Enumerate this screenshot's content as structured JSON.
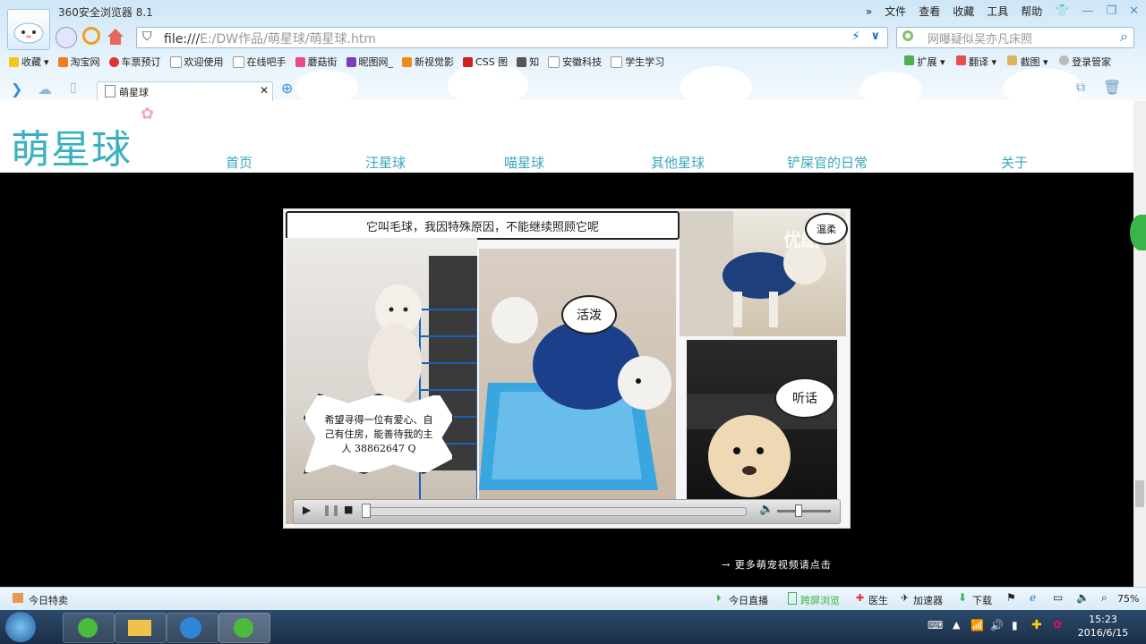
{
  "browser": {
    "app_title": "360安全浏览器 8.1",
    "menu": [
      "文件",
      "查看",
      "收藏",
      "工具",
      "帮助"
    ],
    "address_prefix": "file:///",
    "address_path": "E:/DW作品/萌星球/萌星球.htm",
    "search_placeholder": "网曝疑似吴亦凡床照",
    "bookmarks": [
      "收藏",
      "淘宝网",
      "车票预订",
      "欢迎使用",
      "在线吧手",
      "蘑菇街",
      "昵图网_",
      "新视觉影",
      "CSS 图",
      "知",
      "安徽科技",
      "学生学习"
    ],
    "toolbar_right": [
      "扩展",
      "翻译",
      "截图",
      "登录管家"
    ],
    "tab_title": "萌星球",
    "accent_color": "#3ab0c0"
  },
  "site": {
    "logo": "萌星球",
    "nav": [
      "首页",
      "汪星球",
      "喵星球",
      "其他星球",
      "铲屎官的日常",
      "关于"
    ]
  },
  "video": {
    "banner_text": "它叫毛球，我因特殊原因，不能继续照顾它呢",
    "bubble_left": "希望寻得一位有爱心、自己有住房，能善待我的主人 38862647 Q",
    "bubble_active": "活泼",
    "bubble_gentle": "温柔",
    "bubble_obedient": "听话",
    "watermark": "优酷",
    "more_link": "→ 更多萌宠视频请点击"
  },
  "statusbar": {
    "left": "今日特卖",
    "items": [
      "今日直播",
      "跨屏浏览",
      "医生",
      "加速器",
      "下载"
    ],
    "zoom": "75%"
  },
  "taskbar": {
    "time": "15:23",
    "date": "2016/6/15"
  }
}
